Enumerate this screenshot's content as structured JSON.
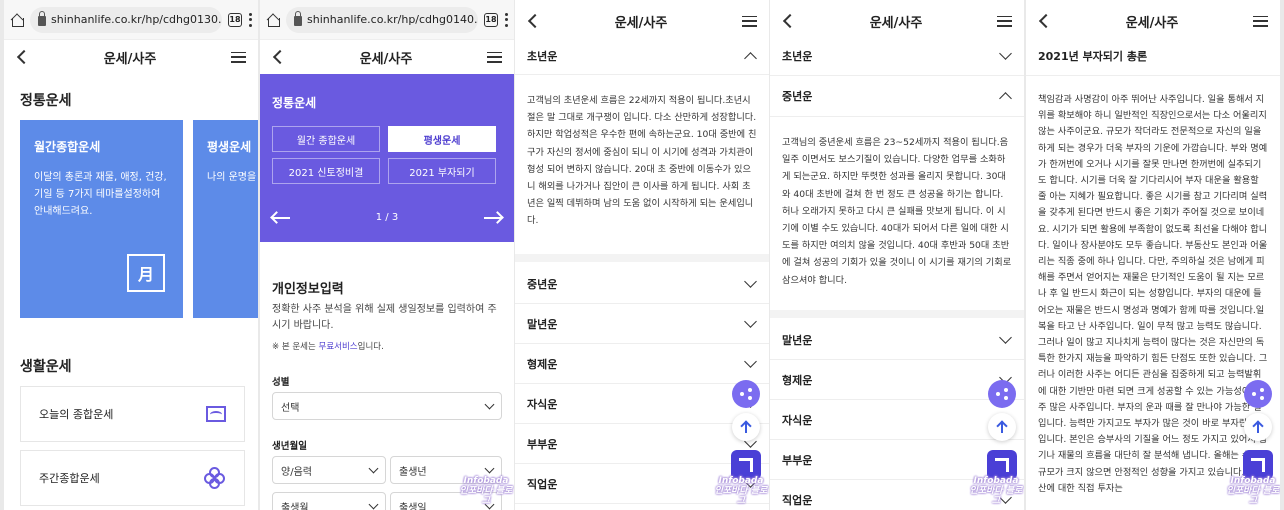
{
  "browser": {
    "url1": "shinhanlife.co.kr/hp/cdhg0130.",
    "url2": "shinhanlife.co.kr/hp/cdhg0140.",
    "tab_count": "18"
  },
  "header": {
    "title": "운세/사주"
  },
  "panel1": {
    "section1_title": "정통운세",
    "card1": {
      "title": "월간종합운세",
      "desc": "이달의 총론과 재물, 애정, 건강, 기일 등 7가지 테마를설정하여 안내해드려요.",
      "badge": "月"
    },
    "card2": {
      "title": "평생운세",
      "desc": "나의 운명을 알고활용해"
    },
    "section2_title": "생활운세",
    "items": [
      "오늘의 종합운세",
      "주간종합운세"
    ]
  },
  "panel2": {
    "title": "정통운세",
    "tabs": [
      "월간 종합운세",
      "평생운세",
      "2021 신토정비결",
      "2021 부자되기"
    ],
    "pager": "1 / 3",
    "form_title": "개인정보입력",
    "form_desc": "정확한 사주 분석을 위해 실제 생일정보를 입력하여 주시기 바랍니다.",
    "note_prefix": "※ 본 운세는 ",
    "note_link": "무료서비스",
    "note_suffix": "입니다.",
    "gender_label": "성별",
    "gender_value": "선택",
    "birth_label": "생년월일",
    "calendar_value": "양/음력",
    "year_value": "출생년",
    "month_value": "출생월",
    "day_value": "출생일"
  },
  "panel3": {
    "open_title": "초년운",
    "open_body": "고객님의 초년운세 흐름은 22세까지 적용이 됩니다.초년시절은 말 그대로 개구쟁이 입니다. 다소 산만하게 성장합니다. 하지만 학업성적은 우수한 편에 속하는군요. 10대 중반에 친구가 자신의 정서에 중심이 되니 이 시기에 성격과 가치관이 형성 되어 변하지 않습니다. 20대 초 중반에 이동수가 있으니 해외를 나가거나 집안이 큰 이사를 하게 됩니다. 사회 초년은 일찍 데뷔하며 남의 도움 없이 시작하게 되는 운세입니다.",
    "items": [
      "중년운",
      "말년운",
      "형제운",
      "자식운",
      "부부운",
      "직업운"
    ]
  },
  "panel4": {
    "top_item": "초년운",
    "open_title": "중년운",
    "open_body": "고객님의 중년운세 흐름은 23~52세까지 적용이 됩니다.음일주 이면서도 보스기질이 있습니다. 다양한 업무를 소화하게 되는군요. 하지만 뚜렷한 성과를 올리지 못합니다. 30대와 40대 초반에 걸쳐 한 번 정도 큰 성공을 하기는 합니다. 허나 오래가지 못하고 다시 큰 실패를 맛보게 됩니다. 이 시기에 이별 수도 있습니다. 40대가 되어서 다른 일에 대한 시도를 하지만 여의치 않을 것입니다. 40대 후반과 50대 초반에 걸쳐 성공의 기회가 있을 것이니 이 시기를 재기의 기회로 삼으셔야 합니다.",
    "items": [
      "말년운",
      "형제운",
      "자식운",
      "부부운",
      "직업운"
    ]
  },
  "panel5": {
    "title": "2021년 부자되기 총론",
    "body": "책임감과 사명감이 아주 뛰어난 사주입니다. 일을 통해서 지위를 확보해야 하니 일반적인 직장인으로서는 다소 어울리지 않는 사주이군요. 규모가 작더라도 전문적으로 자신의 일을 하게 되는 경우가 더욱 부자의 기운에 가깝습니다. 부와 명예가 한꺼번에 오거나 시기를 잘못 만나면 한꺼번에 실추되기도 합니다. 시기를 더욱 잘 기다리시어 부자 대운을 활용할 줄 아는 지혜가 필요합니다. 좋은 시기를 참고 기다리며 실력을 갖추게 된다면 반드시 좋은 기회가 주어질 것으로 보이네요. 시기가 되면 활용에 부족함이 없도록 최선을 다해야 합니다. 일이나 장사분야도 모두 좋습니다. 부동산도 본인과 어울리는 직종 중에 하나 입니다. 다만, 주의하실 것은 남에게 피해를 주면서 얻어지는 재물은 단기적인 도움이 될 지는 모르나 후 일 반드시 화근이 되는 성향입니다. 부자의 대운에 들어오는 재물은 반드시 명성과 명예가 함께 따를 것입니다.일복을 타고 난 사주입니다. 일이 무척 많고 능력도 많습니다. 그러나 일이 많고 지나치게 능력이 많다는 것은 자신만의 독특한 한가지 재능을 파악하기 힘든 단점도 또한 있습니다. 그러나 이러한 사주는 어디든 관심을 집중하게 되고 능력발휘에 대한 기반만 마련 되면 크게 성공할 수 있는 가능성이 아주 많은 사주입니다. 부자의 운과 때를 잘 만나야 가능한 일입니다. 능력만 가지고도 부자가 많은 것이 바로 부자란 단어입니다. 본인은 승부사의 기질을 어느 정도 가지고 있어서 잡기나 재물의 흐름을 대단히 잘 분석해 냅니다. 올해는 수익의 규모가 크지 않으면 안정적인 성향을 가지고 있습니다. 부동산에 대한 직접 투자는"
  },
  "watermark": {
    "line1": "Infobada",
    "line2": "인포바다 블로그"
  }
}
